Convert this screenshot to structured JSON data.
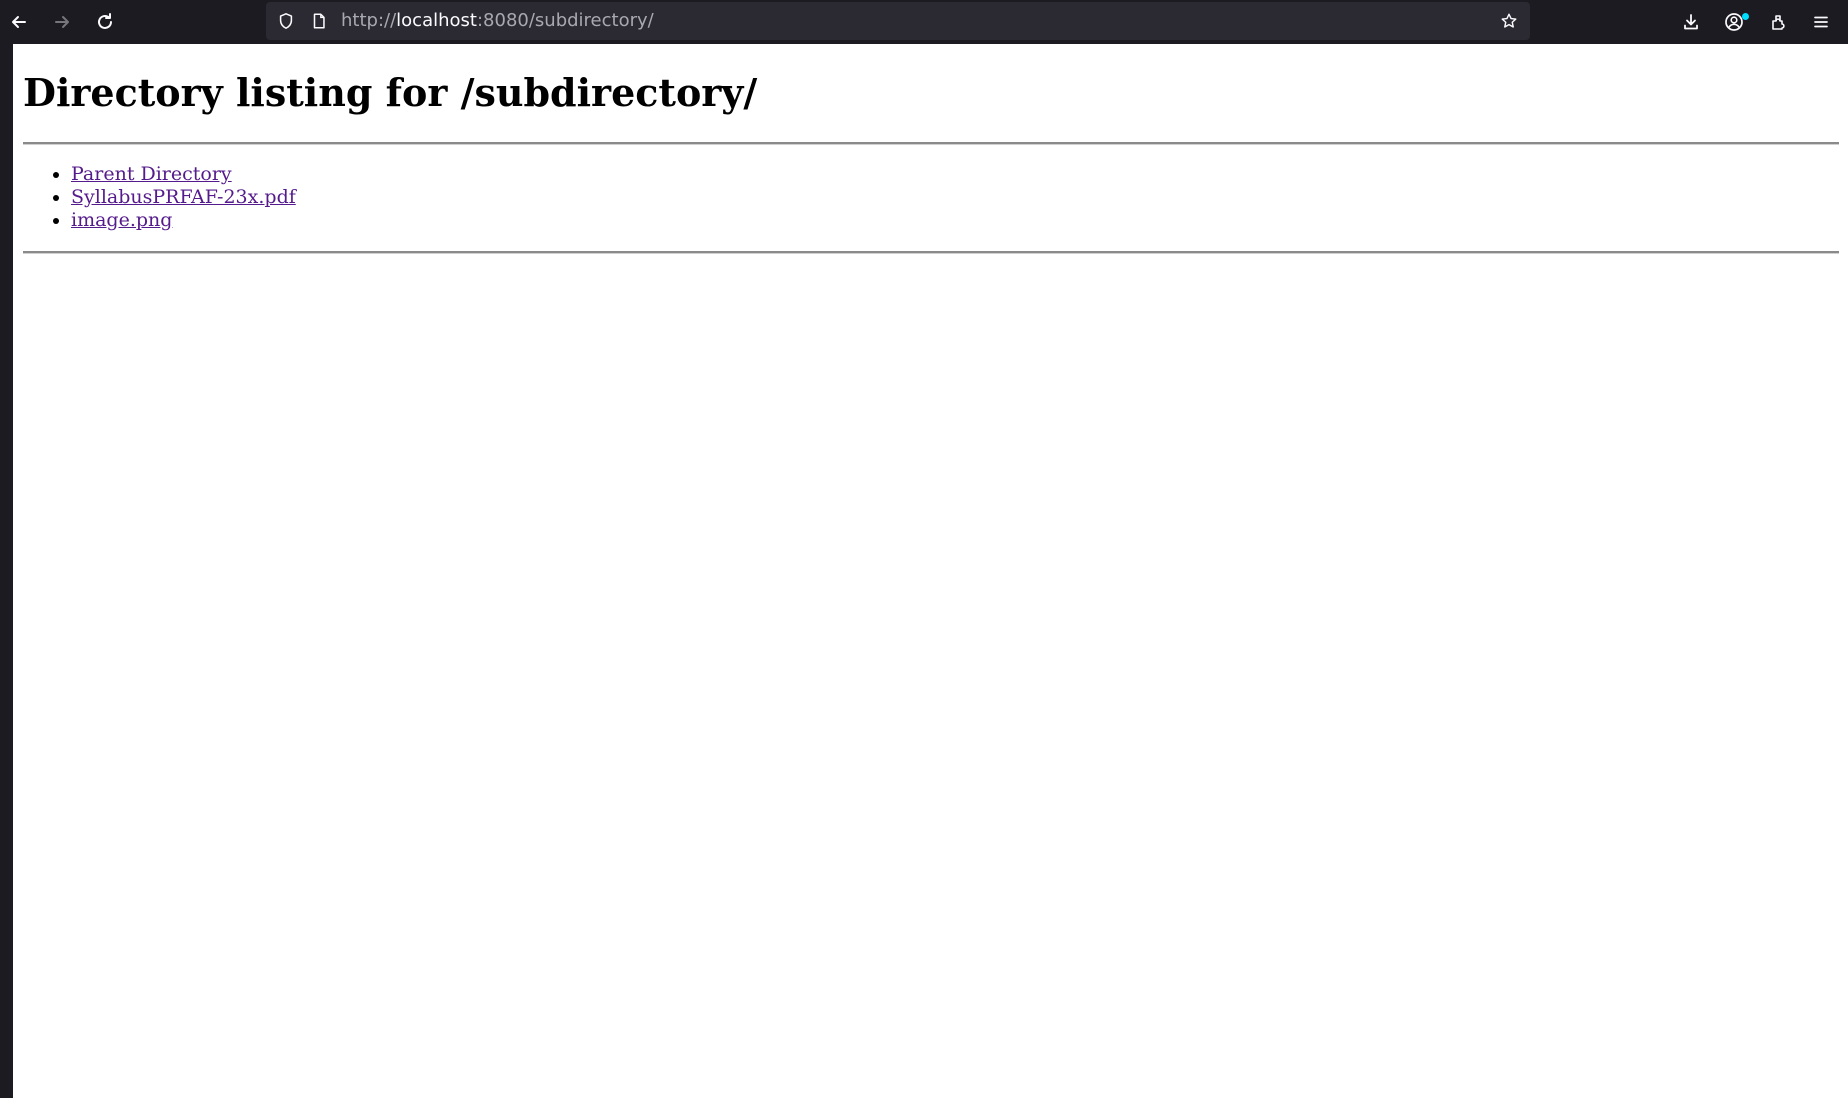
{
  "browser": {
    "url_scheme": "http://",
    "url_host": "localhost",
    "url_rest": ":8080/subdirectory/",
    "icons": {
      "back": "arrow-left-icon",
      "forward": "arrow-right-icon",
      "reload": "reload-icon",
      "tracking_protection": "shield-icon",
      "page_info": "page-icon",
      "bookmark": "star-icon",
      "downloads": "download-icon",
      "account": "account-icon",
      "extensions": "puzzle-icon",
      "menu": "hamburger-menu-icon"
    },
    "colors": {
      "toolbar_bg": "#1c1b22",
      "urlbar_bg": "#2b2a33",
      "notification_dot": "#00ddff"
    }
  },
  "page": {
    "heading": "Directory listing for /subdirectory/",
    "items": [
      {
        "label": "Parent Directory"
      },
      {
        "label": "SyllabusPRFAF-23x.pdf"
      },
      {
        "label": "image.png"
      }
    ],
    "colors": {
      "link_visited": "#551a8b",
      "background": "#ffffff"
    }
  }
}
